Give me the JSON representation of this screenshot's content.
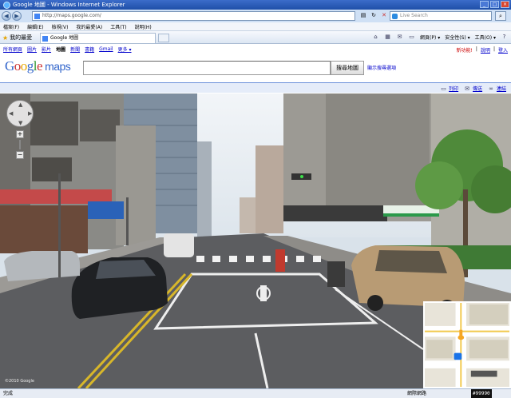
{
  "window": {
    "title": "Google 地圖 - Windows Internet Explorer"
  },
  "address_bar": {
    "url": "http://maps.google.com/",
    "search_placeholder": "Live Search"
  },
  "menu": [
    "檔案(F)",
    "編輯(E)",
    "檢視(V)",
    "我的最愛(A)",
    "工具(T)",
    "說明(H)"
  ],
  "tabs": {
    "favorites_label": "我的最愛",
    "active_tab": "Google 地圖"
  },
  "command_bar": [
    "網頁(P) ▾",
    "安全性(S) ▾",
    "工具(O) ▾"
  ],
  "gbar": {
    "links": [
      "所有網頁",
      "圖片",
      "影片",
      "地圖",
      "新聞",
      "書籍",
      "Gmail",
      "更多 ▾"
    ],
    "user_warning": "新功能!",
    "help": "說明",
    "signin": "登入"
  },
  "search": {
    "button_label": "搜尋地圖",
    "options_link": "顯示搜尋選項"
  },
  "map_links": {
    "print": "列印",
    "send": "傳送",
    "link": "連結"
  },
  "streetview": {
    "copyright": "©2010 Google"
  },
  "status": {
    "left": "完成",
    "zone": "網際網路",
    "zoom": "#99990"
  },
  "colors": {
    "ie_title": "#1f4fa8",
    "link_bar": "#e5ecf9",
    "google_blue": "#3366cc",
    "google_red": "#cc3333"
  }
}
